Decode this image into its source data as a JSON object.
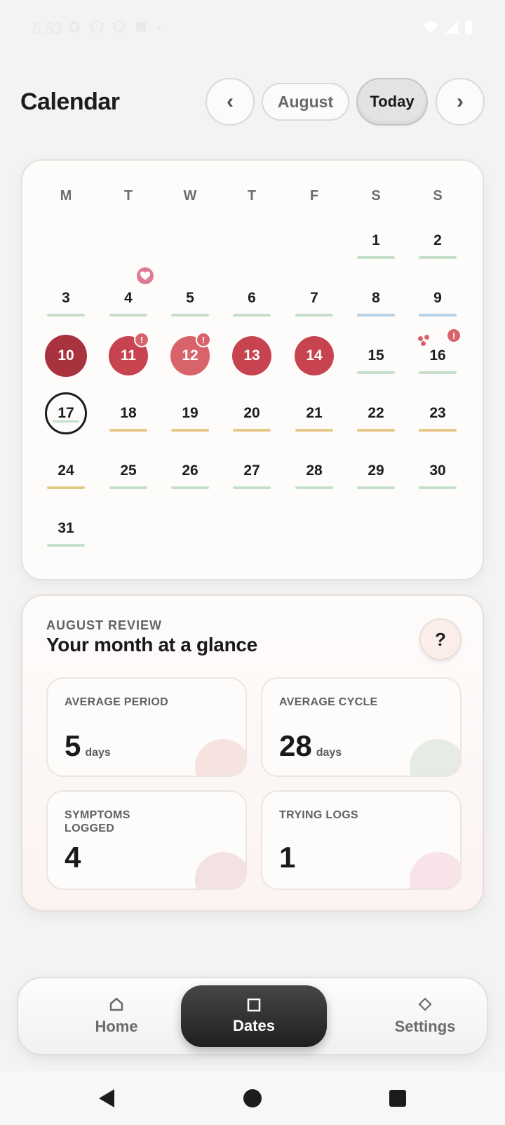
{
  "status_bar": {
    "time": "6:53",
    "left_icons": [
      "settings-icon",
      "info-icon",
      "shield-off-icon",
      "app-icon",
      "dot-icon"
    ],
    "right_icons": [
      "wifi-icon",
      "signal-icon",
      "battery-icon"
    ]
  },
  "header": {
    "title": "Calendar",
    "prev_label": "‹",
    "month_label": "August",
    "today_label": "Today",
    "next_label": "›"
  },
  "calendar": {
    "weekdays": [
      "M",
      "T",
      "W",
      "T",
      "F",
      "S",
      "S"
    ],
    "days": [
      {
        "day": "1",
        "marker": "green"
      },
      {
        "day": "2",
        "marker": "green"
      },
      {
        "day": "3",
        "marker": "green"
      },
      {
        "day": "4",
        "marker": "green",
        "badge": "heart"
      },
      {
        "day": "5",
        "marker": "green"
      },
      {
        "day": "6",
        "marker": "green"
      },
      {
        "day": "7",
        "marker": "green"
      },
      {
        "day": "8",
        "marker": "blue"
      },
      {
        "day": "9",
        "marker": "blue"
      },
      {
        "day": "10",
        "state": "period",
        "shade": "dark"
      },
      {
        "day": "11",
        "state": "period",
        "shade": "mid",
        "badge": "alert"
      },
      {
        "day": "12",
        "state": "period",
        "shade": "light",
        "badge": "alert"
      },
      {
        "day": "13",
        "state": "period",
        "shade": "mid"
      },
      {
        "day": "14",
        "state": "period",
        "shade": "mid"
      },
      {
        "day": "15",
        "marker": "green"
      },
      {
        "day": "16",
        "marker": "green",
        "badge": "alert",
        "dots": true
      },
      {
        "day": "17",
        "marker": "green",
        "state": "today"
      },
      {
        "day": "18",
        "marker": "gold"
      },
      {
        "day": "19",
        "marker": "gold"
      },
      {
        "day": "20",
        "marker": "gold"
      },
      {
        "day": "21",
        "marker": "gold"
      },
      {
        "day": "22",
        "marker": "gold"
      },
      {
        "day": "23",
        "marker": "gold"
      },
      {
        "day": "24",
        "marker": "gold"
      },
      {
        "day": "25",
        "marker": "green"
      },
      {
        "day": "26",
        "marker": "green"
      },
      {
        "day": "27",
        "marker": "green"
      },
      {
        "day": "28",
        "marker": "green"
      },
      {
        "day": "29",
        "marker": "green"
      },
      {
        "day": "30",
        "marker": "green"
      },
      {
        "day": "31",
        "marker": "green"
      }
    ],
    "badge_alert_symbol": "!",
    "colors": {
      "period_dark": "#a8323d",
      "period_mid": "#c7434f",
      "period_light": "#d9636b",
      "marker_green": "#c5dfc8",
      "marker_blue": "#b5d2e6",
      "marker_gold": "#e6c886",
      "heart_badge": "#de7a92"
    }
  },
  "review": {
    "eyebrow": "AUGUST REVIEW",
    "title": "Your month at a glance",
    "help_label": "?",
    "stats": [
      {
        "label": "AVERAGE PERIOD",
        "value": "5",
        "unit": "days",
        "deco_color": "#f6e3e0"
      },
      {
        "label": "AVERAGE CYCLE",
        "value": "28",
        "unit": "days",
        "deco_color": "#e6ece3"
      },
      {
        "label": "SYMPTOMS LOGGED",
        "value": "4",
        "unit": "",
        "deco_color": "#f4e1e1"
      },
      {
        "label": "TRYING LOGS",
        "value": "1",
        "unit": "",
        "deco_color": "#f7e3e8"
      }
    ]
  },
  "bottom_nav": {
    "items": [
      {
        "label": "Home",
        "icon": "home-icon",
        "active": false
      },
      {
        "label": "Dates",
        "icon": "square-icon",
        "active": true
      },
      {
        "label": "Settings",
        "icon": "diamond-icon",
        "active": false
      }
    ]
  },
  "system_nav": {
    "icons": [
      "back-icon",
      "home-circle-icon",
      "recents-icon"
    ]
  }
}
